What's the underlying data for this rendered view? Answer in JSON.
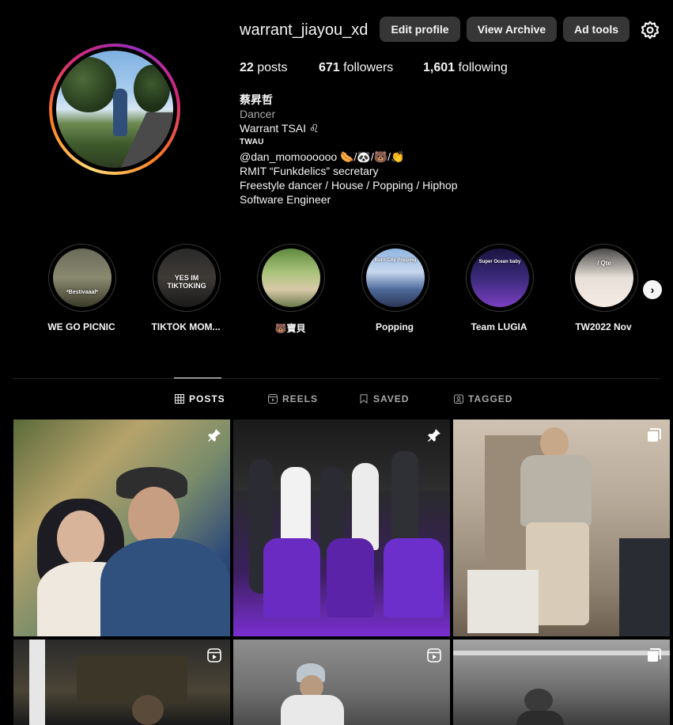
{
  "profile": {
    "username": "warrant_jiayou_xd",
    "buttons": {
      "edit": "Edit profile",
      "archive": "View Archive",
      "ad_tools": "Ad tools"
    },
    "stats": {
      "posts_count": "22",
      "posts_label": "posts",
      "followers_count": "671",
      "followers_label": "followers",
      "following_count": "1,601",
      "following_label": "following"
    },
    "bio": {
      "name": "蔡昇哲",
      "category": "Dancer",
      "line1": "Warrant TSAI ♌",
      "tag": "TWAU",
      "line2": "@dan_momoooooo 🌭/🐼/🐻/👏",
      "line3": "RMIT “Funkdelics” secretary",
      "line4": "Freestyle dancer / House / Popping / Hiphop",
      "line5": "Software Engineer"
    }
  },
  "highlights": [
    {
      "label": "WE GO PICNIC",
      "overlay": "*Bestivaaal*"
    },
    {
      "label": "TIKTOK MOM...",
      "overlay": "YES IM TIKTOKING"
    },
    {
      "label": "🐻寶貝",
      "overlay": ""
    },
    {
      "label": "Popping",
      "overlay": "Burn City Popping"
    },
    {
      "label": "Team LUGIA",
      "overlay": "Super Ocean baby"
    },
    {
      "label": "TW2022 Nov",
      "overlay": "/ Qte"
    }
  ],
  "tabs": {
    "posts": "POSTS",
    "reels": "REELS",
    "saved": "SAVED",
    "tagged": "TAGGED"
  },
  "colors": {
    "background": "#000000",
    "button_bg": "#363636",
    "text_primary": "#f5f5f5",
    "text_secondary": "#a8a8a8"
  },
  "icons": {
    "settings": "gear-icon",
    "next": "chevron-right-icon",
    "pinned": "pin-icon",
    "carousel": "carousel-icon",
    "reel": "reel-icon"
  }
}
